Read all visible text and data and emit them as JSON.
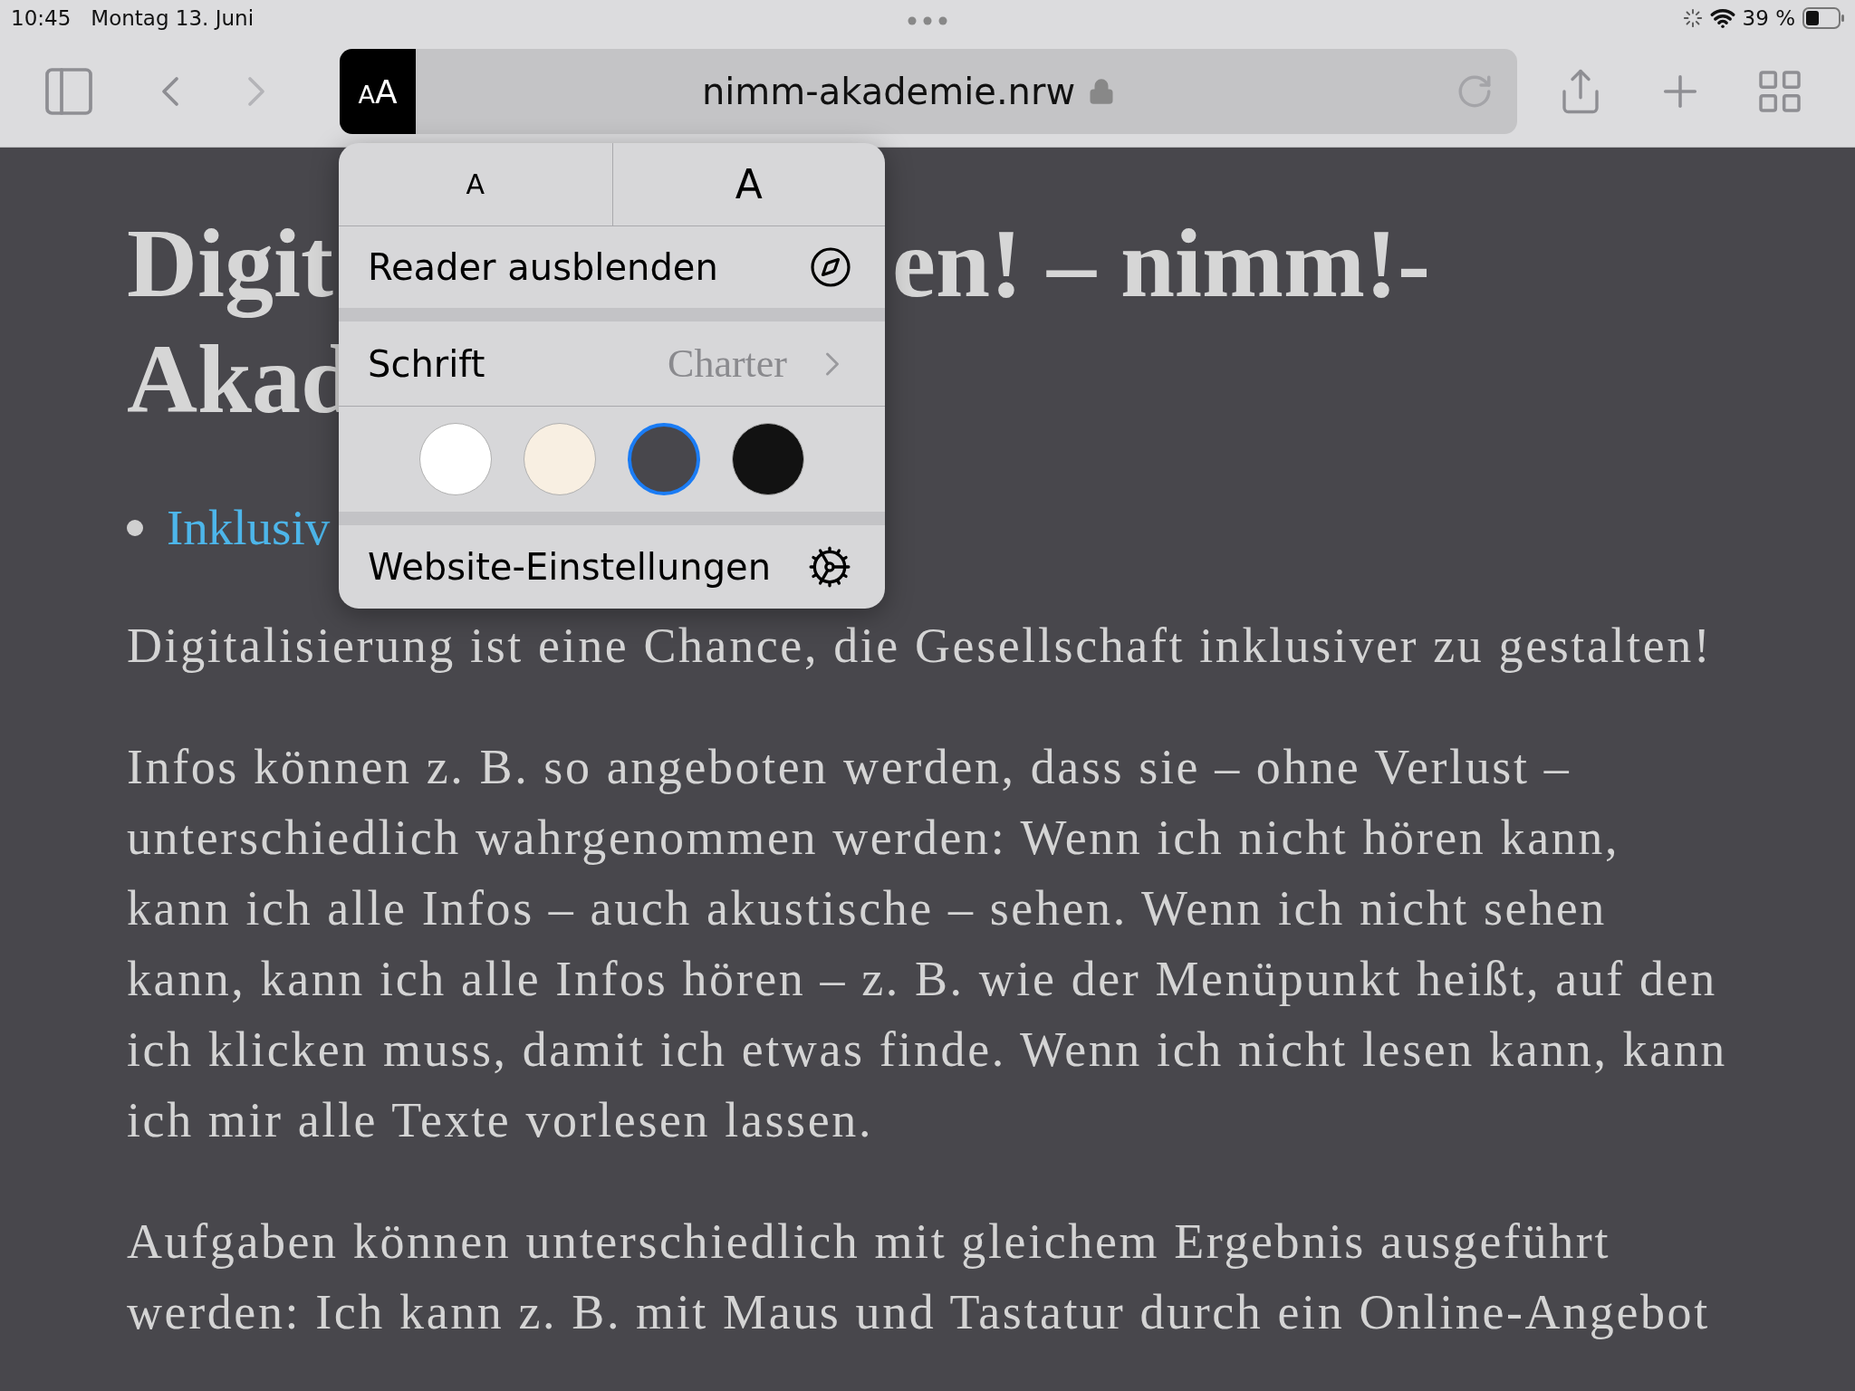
{
  "status_bar": {
    "time": "10:45",
    "date": "Montag 13. Juni",
    "battery": "39 %"
  },
  "toolbar": {
    "reader_button": "AA",
    "url": "nimm-akademie.nrw"
  },
  "article": {
    "title_fragments": [
      "Digit",
      "en! – nimm!-",
      "Akad"
    ],
    "list_items": [
      {
        "kind": "link",
        "text": "Inklusiv"
      }
    ],
    "paragraphs": [
      "Digitalisierung ist eine Chance, die Gesellschaft inklusiver zu gestalten!",
      "Infos können z. B. so angeboten werden, dass sie – ohne Verlust – unterschiedlich wahrgenommen werden: Wenn ich nicht hören kann, kann ich alle Infos – auch akustische – sehen. Wenn ich nicht sehen kann, kann ich alle Infos hören – z. B. wie der Menüpunkt heißt, auf den ich klicken muss, damit ich etwas finde. Wenn ich nicht lesen kann, kann ich mir alle Texte vorlesen lassen.",
      "Aufgaben können unterschiedlich mit gleichem Ergebnis ausgeführt werden: Ich kann z. B. mit Maus und Tastatur durch ein Online-Angebot"
    ]
  },
  "popover": {
    "font_size_buttons": [
      {
        "kind": "smaller",
        "label": "A"
      },
      {
        "kind": "larger",
        "label": "A"
      }
    ],
    "reader_toggle": "Reader ausblenden",
    "font_row": {
      "label": "Schrift",
      "value": "Charter"
    },
    "themes": [
      {
        "color": "#ffffff",
        "selected": false
      },
      {
        "color": "#f8efe2",
        "selected": false
      },
      {
        "color": "#48474c",
        "selected": true
      },
      {
        "color": "#121212",
        "selected": false
      }
    ],
    "website_settings": "Website-Einstellungen"
  }
}
